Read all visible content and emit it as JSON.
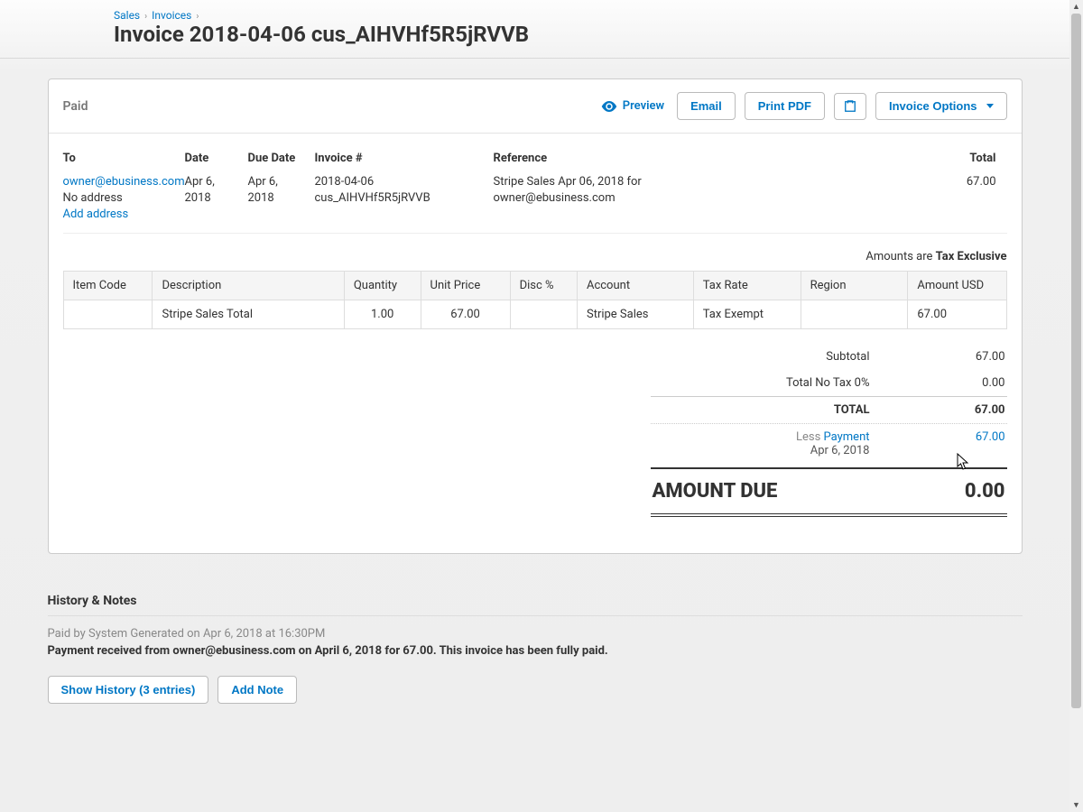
{
  "breadcrumb": {
    "sales": "Sales",
    "invoices": "Invoices"
  },
  "page_title": "Invoice 2018-04-06 cus_AIHVHf5R5jRVVB",
  "status": "Paid",
  "actions": {
    "preview": "Preview",
    "email": "Email",
    "print": "Print PDF",
    "options": "Invoice Options"
  },
  "meta": {
    "to_label": "To",
    "to_email": "owner@ebusiness.com",
    "to_noaddr": "No address",
    "to_addaddr": "Add address",
    "date_label": "Date",
    "date": "Apr 6, 2018",
    "due_label": "Due Date",
    "due": "Apr 6, 2018",
    "inv_label": "Invoice #",
    "inv": "2018-04-06 cus_AIHVHf5R5jRVVB",
    "ref_label": "Reference",
    "ref": "Stripe Sales Apr 06, 2018 for owner@ebusiness.com",
    "total_label": "Total",
    "total": "67.00"
  },
  "amounts_note_prefix": "Amounts are ",
  "amounts_note_bold": "Tax Exclusive",
  "columns": {
    "item": "Item Code",
    "desc": "Description",
    "qty": "Quantity",
    "price": "Unit Price",
    "disc": "Disc %",
    "acct": "Account",
    "rate": "Tax Rate",
    "region": "Region",
    "amt": "Amount USD"
  },
  "lines": [
    {
      "item": "",
      "desc": "Stripe Sales Total",
      "qty": "1.00",
      "price": "67.00",
      "disc": "",
      "acct": "Stripe Sales",
      "rate": "Tax Exempt",
      "region": "",
      "amt": "67.00"
    }
  ],
  "totals": {
    "subtotal_label": "Subtotal",
    "subtotal": "67.00",
    "notax_label": "Total No Tax 0%",
    "notax": "0.00",
    "total_label": "TOTAL",
    "total": "67.00",
    "less_prefix": "Less ",
    "payment_link": "Payment",
    "payment_date": "Apr 6, 2018",
    "payment_amt": "67.00",
    "due_label": "AMOUNT DUE",
    "due": "0.00"
  },
  "history": {
    "title": "History & Notes",
    "line1": "Paid by System Generated on Apr 6, 2018 at 16:30PM",
    "line2": "Payment received from owner@ebusiness.com on April 6, 2018 for 67.00. This invoice has been fully paid.",
    "show": "Show History (3 entries)",
    "add": "Add Note"
  }
}
